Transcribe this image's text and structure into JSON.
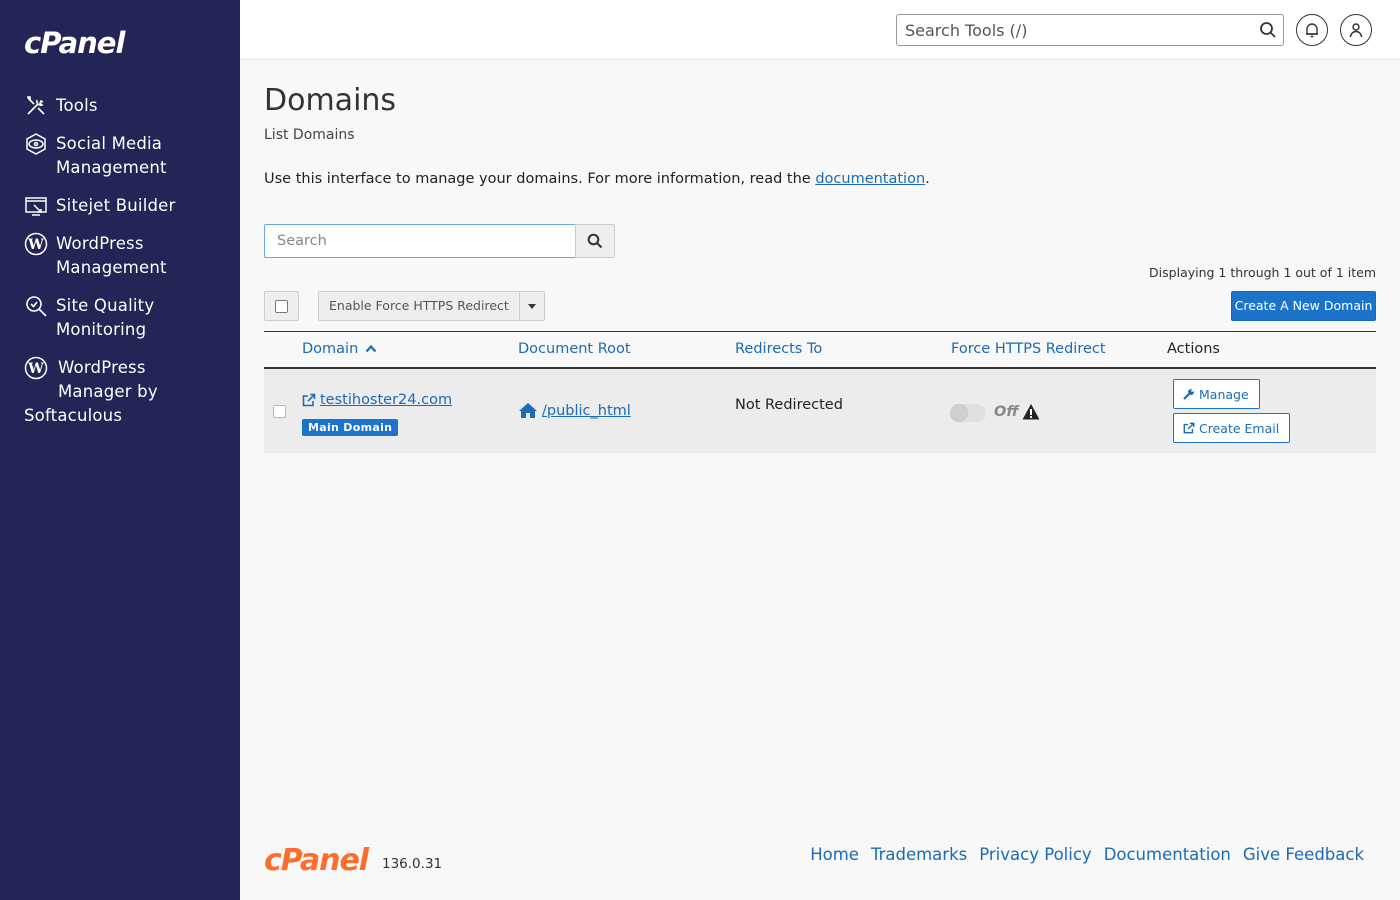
{
  "sidebar": {
    "logo": "cPanel",
    "items": [
      {
        "label": "Tools",
        "icon": "tools-icon"
      },
      {
        "label": "Social Media Management",
        "line1": "Social Media",
        "line2": "Management",
        "icon": "social-media-icon"
      },
      {
        "label": "Sitejet Builder",
        "icon": "sitejet-icon"
      },
      {
        "label": "WordPress Management",
        "line1": "WordPress",
        "line2": "Management",
        "icon": "wordpress-icon"
      },
      {
        "label": "Site Quality Monitoring",
        "line1": "Site Quality",
        "line2": "Monitoring",
        "icon": "site-quality-icon"
      },
      {
        "label": "WordPress Manager by Softaculous",
        "line1": "WordPress",
        "line2": "Manager by",
        "line3": "Softaculous",
        "icon": "wordpress-icon"
      }
    ]
  },
  "topbar": {
    "search_placeholder": "Search Tools (/)"
  },
  "page": {
    "title": "Domains",
    "subtitle": "List Domains",
    "intro_text": "Use this interface to manage your domains. For more information, read the ",
    "intro_link": "documentation",
    "intro_end": "."
  },
  "toolbar": {
    "search_placeholder": "Search",
    "displaying": "Displaying 1 through 1 out of 1 item",
    "bulk_action": "Enable Force HTTPS Redirect",
    "create_button": "Create A New Domain"
  },
  "table": {
    "headers": {
      "domain": "Domain",
      "document_root": "Document Root",
      "redirects_to": "Redirects To",
      "force_https": "Force HTTPS Redirect",
      "actions": "Actions"
    },
    "rows": [
      {
        "domain": "testihoster24.com",
        "badge": "Main Domain",
        "document_root": "/public_html",
        "redirects_to": "Not Redirected",
        "force_https": "Off",
        "actions": [
          "Manage",
          "Create Email"
        ]
      }
    ]
  },
  "footer": {
    "logo": "cPanel",
    "version": "136.0.31",
    "links": [
      "Home",
      "Trademarks",
      "Privacy Policy",
      "Documentation",
      "Give Feedback"
    ]
  },
  "colors": {
    "sidebar_bg": "#222556",
    "accent": "#1b74c9",
    "link": "#1b6bb5",
    "footer_logo": "#ff6c2c"
  }
}
